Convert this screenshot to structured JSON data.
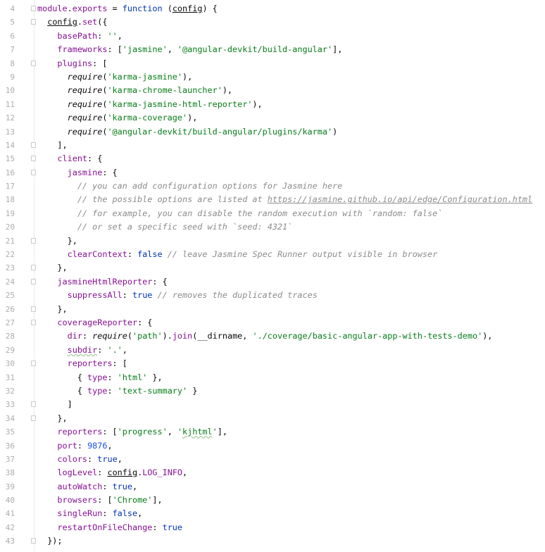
{
  "editor": {
    "lines": [
      {
        "num": "4",
        "fold": true,
        "tokens": [
          [
            "p",
            "module"
          ],
          [
            "t",
            "."
          ],
          [
            "p",
            "exports"
          ],
          [
            "t",
            " = "
          ],
          [
            "k",
            "function"
          ],
          [
            "t",
            " ("
          ],
          [
            "u",
            "config"
          ],
          [
            "t",
            ") {"
          ]
        ]
      },
      {
        "num": "5",
        "fold": true,
        "tokens": [
          [
            "t",
            "  "
          ],
          [
            "u",
            "config"
          ],
          [
            "t",
            "."
          ],
          [
            "p",
            "set"
          ],
          [
            "t",
            "({"
          ]
        ]
      },
      {
        "num": "6",
        "tokens": [
          [
            "t",
            "    "
          ],
          [
            "p",
            "basePath"
          ],
          [
            "t",
            ": "
          ],
          [
            "s",
            "''"
          ],
          [
            "t",
            ","
          ]
        ]
      },
      {
        "num": "7",
        "tokens": [
          [
            "t",
            "    "
          ],
          [
            "p",
            "frameworks"
          ],
          [
            "t",
            ": ["
          ],
          [
            "s",
            "'jasmine'"
          ],
          [
            "t",
            ", "
          ],
          [
            "s",
            "'@angular-devkit/build-angular'"
          ],
          [
            "t",
            "],"
          ]
        ]
      },
      {
        "num": "8",
        "fold": true,
        "tokens": [
          [
            "t",
            "    "
          ],
          [
            "p",
            "plugins"
          ],
          [
            "t",
            ": ["
          ]
        ]
      },
      {
        "num": "9",
        "tokens": [
          [
            "t",
            "      "
          ],
          [
            "i",
            "require"
          ],
          [
            "t",
            "("
          ],
          [
            "s",
            "'karma-jasmine'"
          ],
          [
            "t",
            "),"
          ]
        ]
      },
      {
        "num": "10",
        "tokens": [
          [
            "t",
            "      "
          ],
          [
            "i",
            "require"
          ],
          [
            "t",
            "("
          ],
          [
            "s",
            "'karma-chrome-launcher'"
          ],
          [
            "t",
            "),"
          ]
        ]
      },
      {
        "num": "11",
        "tokens": [
          [
            "t",
            "      "
          ],
          [
            "i",
            "require"
          ],
          [
            "t",
            "("
          ],
          [
            "s",
            "'karma-jasmine-html-reporter'"
          ],
          [
            "t",
            "),"
          ]
        ]
      },
      {
        "num": "12",
        "tokens": [
          [
            "t",
            "      "
          ],
          [
            "i",
            "require"
          ],
          [
            "t",
            "("
          ],
          [
            "s",
            "'karma-coverage'"
          ],
          [
            "t",
            "),"
          ]
        ]
      },
      {
        "num": "13",
        "tokens": [
          [
            "t",
            "      "
          ],
          [
            "i",
            "require"
          ],
          [
            "t",
            "("
          ],
          [
            "s",
            "'@angular-devkit/build-angular/plugins/karma'"
          ],
          [
            "t",
            ")"
          ]
        ]
      },
      {
        "num": "14",
        "fold": true,
        "tokens": [
          [
            "t",
            "    ],"
          ]
        ]
      },
      {
        "num": "15",
        "fold": true,
        "tokens": [
          [
            "t",
            "    "
          ],
          [
            "p",
            "client"
          ],
          [
            "t",
            ": {"
          ]
        ]
      },
      {
        "num": "16",
        "fold": true,
        "tokens": [
          [
            "t",
            "      "
          ],
          [
            "p",
            "jasmine"
          ],
          [
            "t",
            ": {"
          ]
        ]
      },
      {
        "num": "17",
        "tokens": [
          [
            "t",
            "        "
          ],
          [
            "c",
            "// you can add configuration options for Jasmine here"
          ]
        ]
      },
      {
        "num": "18",
        "tokens": [
          [
            "t",
            "        "
          ],
          [
            "c",
            "// the possible options are listed at "
          ],
          [
            "cu",
            "https://jasmine.github.io/api/edge/Configuration.html"
          ]
        ]
      },
      {
        "num": "19",
        "tokens": [
          [
            "t",
            "        "
          ],
          [
            "c",
            "// for example, you can disable the random execution with `random: false`"
          ]
        ]
      },
      {
        "num": "20",
        "tokens": [
          [
            "t",
            "        "
          ],
          [
            "c",
            "// or set a specific seed with `seed: 4321`"
          ]
        ]
      },
      {
        "num": "21",
        "fold": true,
        "tokens": [
          [
            "t",
            "      },"
          ]
        ]
      },
      {
        "num": "22",
        "tokens": [
          [
            "t",
            "      "
          ],
          [
            "p",
            "clearContext"
          ],
          [
            "t",
            ": "
          ],
          [
            "k",
            "false"
          ],
          [
            "t",
            " "
          ],
          [
            "c",
            "// leave Jasmine Spec Runner output visible in browser"
          ]
        ]
      },
      {
        "num": "23",
        "fold": true,
        "tokens": [
          [
            "t",
            "    },"
          ]
        ]
      },
      {
        "num": "24",
        "fold": true,
        "tokens": [
          [
            "t",
            "    "
          ],
          [
            "p",
            "jasmineHtmlReporter"
          ],
          [
            "t",
            ": {"
          ]
        ]
      },
      {
        "num": "25",
        "tokens": [
          [
            "t",
            "      "
          ],
          [
            "p",
            "suppressAll"
          ],
          [
            "t",
            ": "
          ],
          [
            "k",
            "true"
          ],
          [
            "t",
            " "
          ],
          [
            "c",
            "// removes the duplicated traces"
          ]
        ]
      },
      {
        "num": "26",
        "fold": true,
        "tokens": [
          [
            "t",
            "    },"
          ]
        ]
      },
      {
        "num": "27",
        "fold": true,
        "tokens": [
          [
            "t",
            "    "
          ],
          [
            "p",
            "coverageReporter"
          ],
          [
            "t",
            ": {"
          ]
        ]
      },
      {
        "num": "28",
        "tokens": [
          [
            "t",
            "      "
          ],
          [
            "p",
            "dir"
          ],
          [
            "t",
            ": "
          ],
          [
            "i",
            "require"
          ],
          [
            "t",
            "("
          ],
          [
            "s",
            "'path'"
          ],
          [
            "t",
            ")."
          ],
          [
            "p",
            "join"
          ],
          [
            "t",
            "(__dirname, "
          ],
          [
            "s",
            "'./coverage/basic-angular-app-with-tests-demo'"
          ],
          [
            "t",
            "),"
          ]
        ]
      },
      {
        "num": "29",
        "tokens": [
          [
            "t",
            "      "
          ],
          [
            "pw",
            "subdir"
          ],
          [
            "t",
            ": "
          ],
          [
            "s",
            "'.'"
          ],
          [
            "t",
            ","
          ]
        ]
      },
      {
        "num": "30",
        "fold": true,
        "tokens": [
          [
            "t",
            "      "
          ],
          [
            "p",
            "reporters"
          ],
          [
            "t",
            ": ["
          ]
        ]
      },
      {
        "num": "31",
        "tokens": [
          [
            "t",
            "        { "
          ],
          [
            "p",
            "type"
          ],
          [
            "t",
            ": "
          ],
          [
            "s",
            "'html'"
          ],
          [
            "t",
            " },"
          ]
        ]
      },
      {
        "num": "32",
        "tokens": [
          [
            "t",
            "        { "
          ],
          [
            "p",
            "type"
          ],
          [
            "t",
            ": "
          ],
          [
            "s",
            "'text-summary'"
          ],
          [
            "t",
            " }"
          ]
        ]
      },
      {
        "num": "33",
        "fold": true,
        "tokens": [
          [
            "t",
            "      ]"
          ]
        ]
      },
      {
        "num": "34",
        "fold": true,
        "tokens": [
          [
            "t",
            "    },"
          ]
        ]
      },
      {
        "num": "35",
        "tokens": [
          [
            "t",
            "    "
          ],
          [
            "p",
            "reporters"
          ],
          [
            "t",
            ": ["
          ],
          [
            "s",
            "'progress'"
          ],
          [
            "t",
            ", "
          ],
          [
            "s",
            "'"
          ],
          [
            "sw",
            "kjhtml"
          ],
          [
            "s",
            "'"
          ],
          [
            "t",
            "],"
          ]
        ]
      },
      {
        "num": "36",
        "tokens": [
          [
            "t",
            "    "
          ],
          [
            "p",
            "port"
          ],
          [
            "t",
            ": "
          ],
          [
            "n",
            "9876"
          ],
          [
            "t",
            ","
          ]
        ]
      },
      {
        "num": "37",
        "tokens": [
          [
            "t",
            "    "
          ],
          [
            "p",
            "colors"
          ],
          [
            "t",
            ": "
          ],
          [
            "k",
            "true"
          ],
          [
            "t",
            ","
          ]
        ]
      },
      {
        "num": "38",
        "tokens": [
          [
            "t",
            "    "
          ],
          [
            "p",
            "logLevel"
          ],
          [
            "t",
            ": "
          ],
          [
            "u",
            "config"
          ],
          [
            "t",
            "."
          ],
          [
            "p",
            "LOG_INFO"
          ],
          [
            "t",
            ","
          ]
        ]
      },
      {
        "num": "39",
        "tokens": [
          [
            "t",
            "    "
          ],
          [
            "p",
            "autoWatch"
          ],
          [
            "t",
            ": "
          ],
          [
            "k",
            "true"
          ],
          [
            "t",
            ","
          ]
        ]
      },
      {
        "num": "40",
        "tokens": [
          [
            "t",
            "    "
          ],
          [
            "p",
            "browsers"
          ],
          [
            "t",
            ": ["
          ],
          [
            "s",
            "'Chrome'"
          ],
          [
            "t",
            "],"
          ]
        ]
      },
      {
        "num": "41",
        "tokens": [
          [
            "t",
            "    "
          ],
          [
            "p",
            "singleRun"
          ],
          [
            "t",
            ": "
          ],
          [
            "k",
            "false"
          ],
          [
            "t",
            ","
          ]
        ]
      },
      {
        "num": "42",
        "tokens": [
          [
            "t",
            "    "
          ],
          [
            "p",
            "restartOnFileChange"
          ],
          [
            "t",
            ": "
          ],
          [
            "k",
            "true"
          ]
        ]
      },
      {
        "num": "43",
        "fold": true,
        "tokens": [
          [
            "t",
            "  });"
          ]
        ]
      }
    ]
  }
}
